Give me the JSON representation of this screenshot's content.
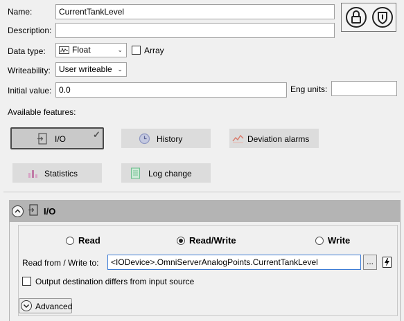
{
  "form": {
    "name_label": "Name:",
    "name_value": "CurrentTankLevel",
    "description_label": "Description:",
    "description_value": "",
    "datatype_label": "Data type:",
    "datatype_value": "Float",
    "array_label": "Array",
    "writeability_label": "Writeability:",
    "writeability_value": "User writeable",
    "initial_label": "Initial value:",
    "initial_value": "0.0",
    "eng_units_label": "Eng units:",
    "eng_units_value": ""
  },
  "toolbar": {
    "lock_icon": "lock-icon",
    "shield_icon": "shield-icon"
  },
  "features": {
    "title": "Available features:",
    "items": [
      {
        "label": "I/O",
        "icon": "io-icon",
        "active": true
      },
      {
        "label": "History",
        "icon": "history-icon",
        "active": false
      },
      {
        "label": "Deviation alarms",
        "icon": "deviation-alarm-icon",
        "active": false
      },
      {
        "label": "Statistics",
        "icon": "statistics-icon",
        "active": false
      },
      {
        "label": "Log change",
        "icon": "log-change-icon",
        "active": false
      }
    ]
  },
  "io_panel": {
    "title": "I/O",
    "modes": [
      {
        "label": "Read",
        "selected": false
      },
      {
        "label": "Read/Write",
        "selected": true
      },
      {
        "label": "Write",
        "selected": false
      }
    ],
    "source_label": "Read from / Write to:",
    "source_value": "<IODevice>.OmniServerAnalogPoints.CurrentTankLevel",
    "browse_label": "...",
    "diff_label": "Output destination differs from input source",
    "advanced_label": "Advanced"
  },
  "colors": {
    "panel_header": "#b4b4b4",
    "background": "#f0f0f0",
    "feature_button": "#dcdcdc",
    "history_icon": "#9aa2c8",
    "deviation_icon": "#d97a6a",
    "statistics_icon": "#c07aa6",
    "log_icon": "#6fbf8f"
  }
}
